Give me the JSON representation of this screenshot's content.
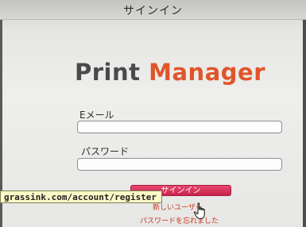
{
  "window": {
    "title": "サインイン"
  },
  "logo": {
    "part1": "Print",
    "part2": "Manager",
    "colors": {
      "print": "#4a4a4a",
      "manager": "#e0552b"
    }
  },
  "form": {
    "email_label": "Eメール",
    "email_value": "",
    "password_label": "パスワード",
    "password_value": "",
    "signin_label": "サインイン",
    "signin_color": "#d9305a"
  },
  "links": {
    "new_user": "新しいユーザー",
    "forgot_password": "パスワードを忘れました",
    "color": "#c4391f"
  },
  "status_tooltip": {
    "url": "grassink.com/account/register"
  },
  "cursor": {
    "type": "hand-pointer-icon"
  }
}
